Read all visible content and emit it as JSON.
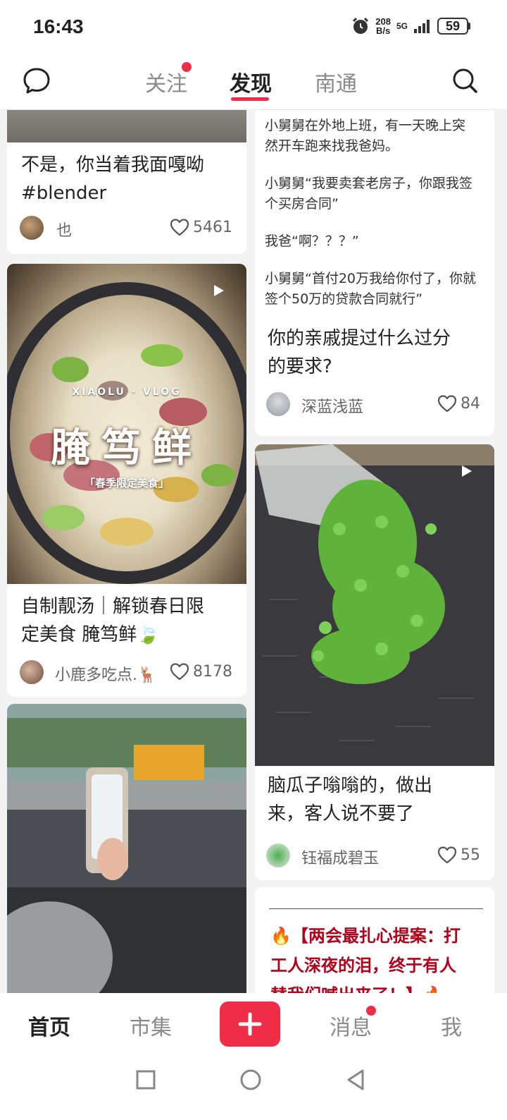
{
  "status_bar": {
    "time": "16:43",
    "net_speed_value": "208",
    "net_speed_unit": "B/s",
    "network": "5G",
    "battery": "59"
  },
  "top_nav": {
    "tabs": [
      {
        "label": "关注",
        "has_dot": true
      },
      {
        "label": "发现",
        "active": true
      },
      {
        "label": "南通"
      }
    ]
  },
  "feed": {
    "left": [
      {
        "title_line1": "不是，你当着我面嘎呦",
        "title_line2": "#blender",
        "author": "也",
        "likes": "5461"
      },
      {
        "image_title": "腌笃鲜",
        "image_sub": "XIAOLU · VLOG",
        "image_tag": "「春季限定美食」",
        "title_line1": "自制靓汤｜解锁春日限",
        "title_line2": "定美食 腌笃鲜🍃",
        "author": "小鹿多吃点.🦌",
        "likes": "8178"
      },
      {
        "kind": "video-photo"
      }
    ],
    "right": [
      {
        "body": [
          "小舅舅在外地上班，有一天晚上突",
          "然开车跑来找我爸妈。",
          "小舅舅“我要卖套老房子，你跟我签",
          "个买房合同”",
          "我爸“啊？？？”",
          "小舅舅“首付20万我给你付了，你就",
          "签个50万的贷款合同就行”"
        ],
        "title_line1": "你的亲戚提过什么过分",
        "title_line2": "的要求?",
        "author": "深蓝浅蓝",
        "likes": "84"
      },
      {
        "title_line1": "脑瓜子嗡嗡的，做出",
        "title_line2": "来，客人说不要了",
        "author": "钰福成碧玉",
        "likes": "55"
      },
      {
        "headline_line1": "🔥【两会最扎心提案：打",
        "headline_line2": "工人深夜的泪，终于有人",
        "headline_line3": "替我们喊出来了！】🔥"
      }
    ]
  },
  "bottom_nav": {
    "home": "首页",
    "market": "市集",
    "messages": "消息",
    "me": "我"
  },
  "colors": {
    "accent": "#ef2d46",
    "background": "#f3f3f3",
    "text": "#222222"
  }
}
